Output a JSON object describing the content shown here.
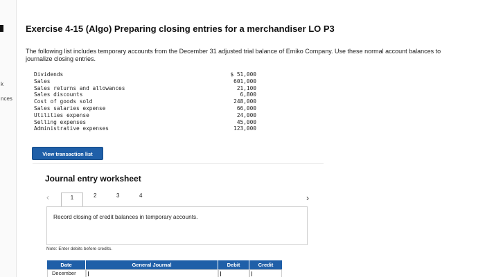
{
  "sidebar": {
    "fragments": [
      "k",
      "nces"
    ]
  },
  "exercise": {
    "title": "Exercise 4-15 (Algo) Preparing closing entries for a merchandiser LO P3",
    "intro": "The following list includes temporary accounts from the December 31 adjusted trial balance of Emiko Company. Use these normal account balances to journalize closing entries."
  },
  "accounts": [
    {
      "name": "Dividends",
      "amount": "$ 51,000"
    },
    {
      "name": "Sales",
      "amount": "601,000"
    },
    {
      "name": "Sales returns and allowances",
      "amount": "21,100"
    },
    {
      "name": "Sales discounts",
      "amount": "6,800"
    },
    {
      "name": "Cost of goods sold",
      "amount": "248,000"
    },
    {
      "name": "Sales salaries expense",
      "amount": "66,000"
    },
    {
      "name": "Utilities expense",
      "amount": "24,000"
    },
    {
      "name": "Selling expenses",
      "amount": "45,000"
    },
    {
      "name": "Administrative expenses",
      "amount": "123,000"
    }
  ],
  "buttons": {
    "view_transactions": "View transaction list"
  },
  "worksheet": {
    "title": "Journal entry worksheet",
    "pages": [
      "1",
      "2",
      "3",
      "4"
    ],
    "active_page": "1",
    "instruction": "Record closing of credit balances in temporary accounts.",
    "note": "Note: Enter debits before credits."
  },
  "table": {
    "headers": {
      "date": "Date",
      "journal": "General Journal",
      "debit": "Debit",
      "credit": "Credit"
    },
    "rows": [
      {
        "date": "December",
        "journal": "",
        "debit": "",
        "credit": ""
      }
    ]
  },
  "colors": {
    "accent": "#1f5fa8",
    "border": "#cfcfcf"
  }
}
